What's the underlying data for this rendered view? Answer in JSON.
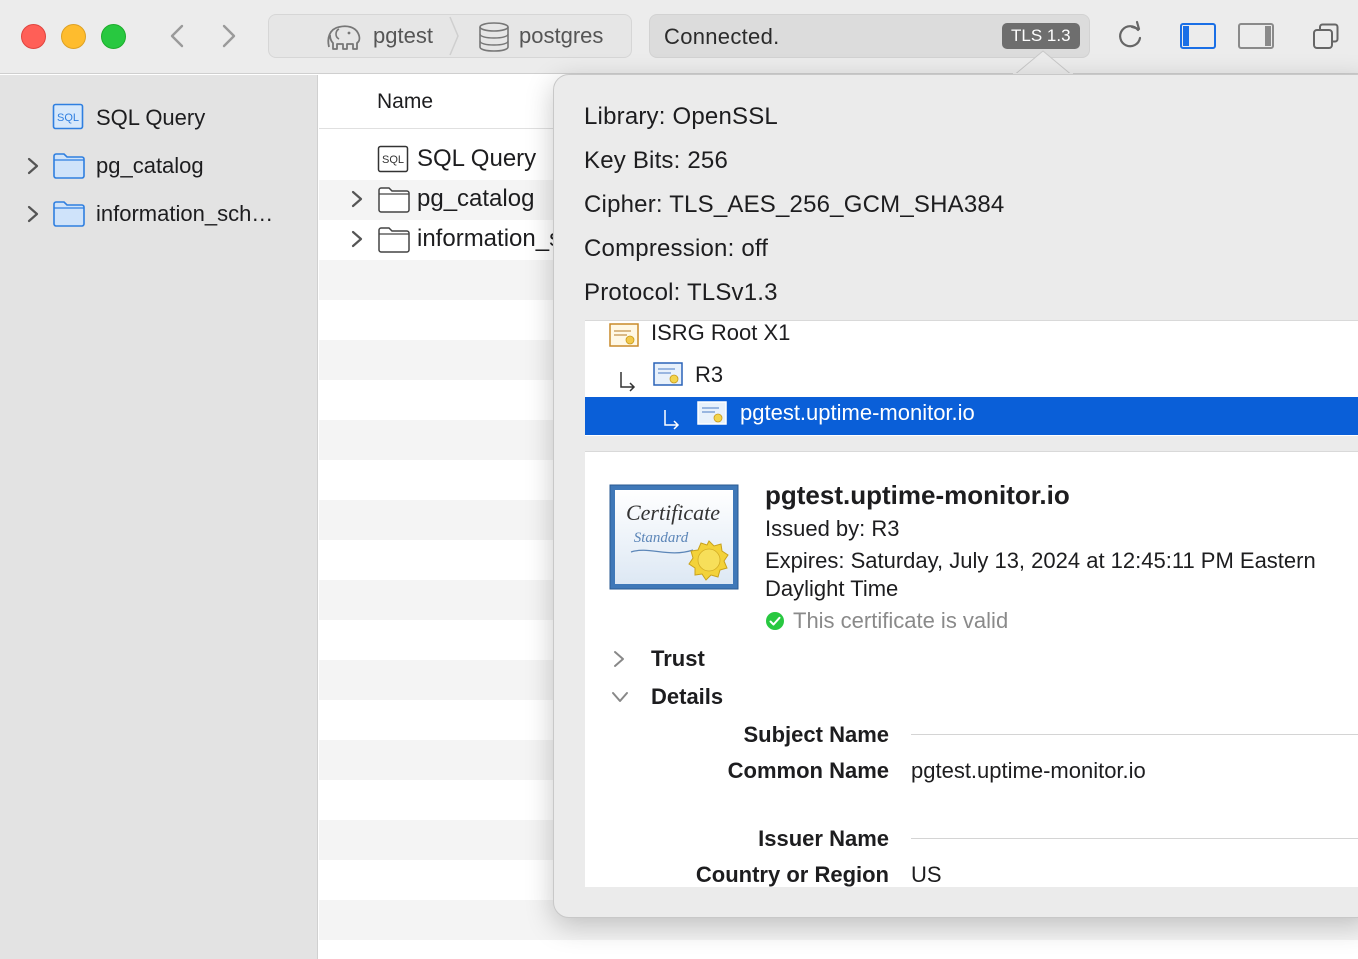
{
  "toolbar": {
    "breadcrumb": {
      "server": "pgtest",
      "database": "postgres"
    },
    "status_text": "Connected.",
    "tls_badge": "TLS 1.3"
  },
  "sidebar": {
    "items": [
      {
        "label": "SQL Query",
        "icon": "sql-query-icon",
        "icon_text": "SQL"
      },
      {
        "label": "pg_catalog",
        "icon": "folder-icon"
      },
      {
        "label": "information_sch…",
        "icon": "folder-icon"
      }
    ]
  },
  "list": {
    "column_header": "Name",
    "rows": [
      {
        "label": "SQL Query",
        "icon_text": "SQL"
      },
      {
        "label": "pg_catalog"
      },
      {
        "label": "information_schema"
      }
    ]
  },
  "popover": {
    "library": "Library: OpenSSL",
    "key_bits": "Key Bits: 256",
    "cipher": "Cipher: TLS_AES_256_GCM_SHA384",
    "compression": "Compression: off",
    "protocol": "Protocol: TLSv1.3",
    "chain": [
      {
        "label": "ISRG Root X1"
      },
      {
        "label": "R3"
      },
      {
        "label": "pgtest.uptime-monitor.io",
        "selected": true
      }
    ],
    "certificate": {
      "name": "pgtest.uptime-monitor.io",
      "issued_by": "Issued by: R3",
      "expires_line1": "Expires: Saturday, July 13, 2024 at 12:45:11 PM Eastern",
      "expires_line2": "Daylight Time",
      "valid_text": "This certificate is valid",
      "trust_label": "Trust",
      "details_label": "Details",
      "subject_name_label": "Subject Name",
      "common_name_label": "Common Name",
      "common_name_value": "pgtest.uptime-monitor.io",
      "issuer_name_label": "Issuer Name",
      "country_label": "Country or Region",
      "country_value": "US",
      "image_text_1": "Certificate",
      "image_text_2": "Standard"
    }
  },
  "colors": {
    "selection": "#0a5fd8",
    "valid_green": "#28c840",
    "accent_blue": "#1a6fe6"
  }
}
